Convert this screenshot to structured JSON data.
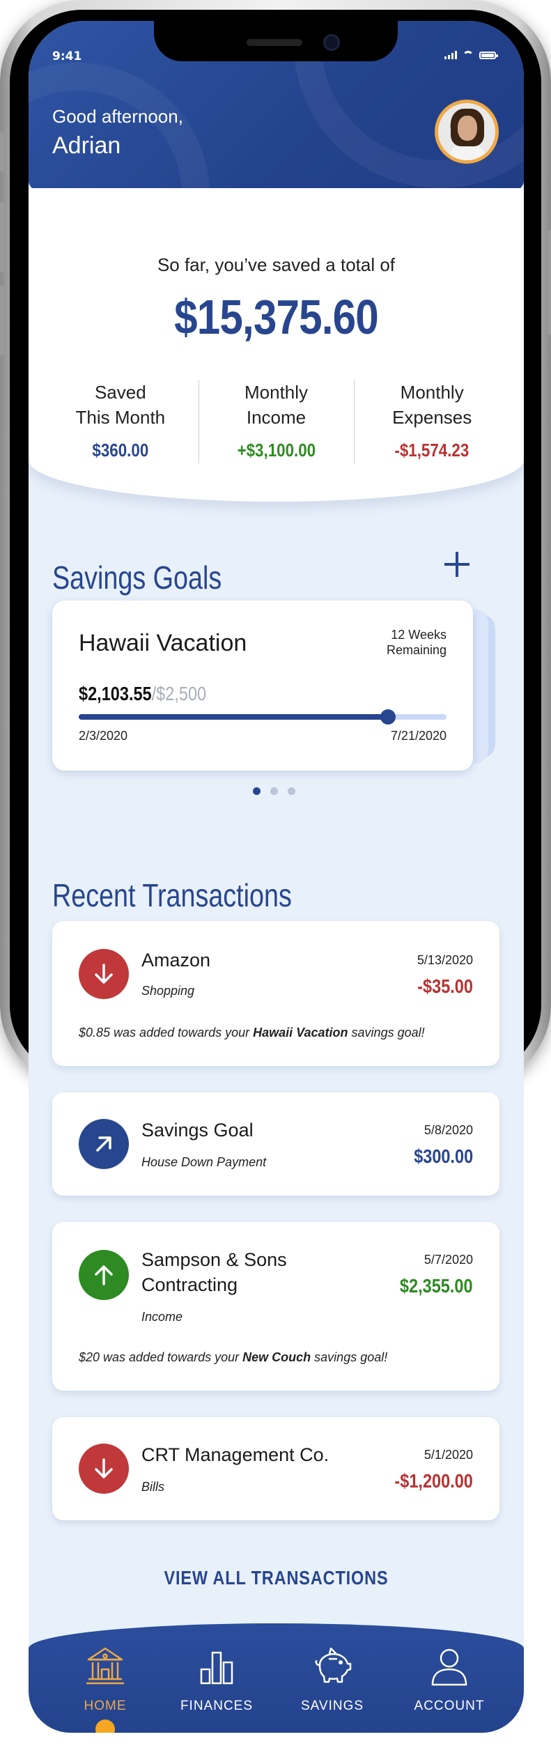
{
  "status": {
    "time": "9:41"
  },
  "header": {
    "greeting": "Good afternoon,",
    "user_name": "Adrian"
  },
  "summary": {
    "total_label": "So far, you’ve saved a total of",
    "total_amount": "$15,375.60",
    "stats": [
      {
        "label": "Saved\nThis Month",
        "value": "$360.00",
        "color": "#28468f"
      },
      {
        "label": "Monthly\nIncome",
        "value": "+$3,100.00",
        "color": "#2e8a22"
      },
      {
        "label": "Monthly\nExpenses",
        "value": "-$1,574.23",
        "color": "#b83232"
      }
    ]
  },
  "savings_goals": {
    "title": "Savings Goals",
    "current": {
      "name": "Hawaii Vacation",
      "remaining": "12 Weeks\nRemaining",
      "saved": "$2,103.55",
      "target": "/$2,500",
      "progress": 0.8414,
      "start_date": "2/3/2020",
      "end_date": "7/21/2020"
    },
    "page_count": 3,
    "active_page": 0
  },
  "transactions": {
    "title": "Recent Transactions",
    "items": [
      {
        "name": "Amazon",
        "category": "Shopping",
        "date": "5/13/2020",
        "amount": "-$35.00",
        "amount_color": "#b83232",
        "icon": "arrow-down-icon",
        "icon_color": "#c0383a",
        "note_pre": "$0.85 was added towards your ",
        "note_bold": "Hawaii Vacation",
        "note_post": " savings goal!"
      },
      {
        "name": "Savings Goal",
        "category": "House Down Payment",
        "date": "5/8/2020",
        "amount": "$300.00",
        "amount_color": "#28468f",
        "icon": "arrow-up-right-icon",
        "icon_color": "#28468f"
      },
      {
        "name": "Sampson & Sons\nContracting",
        "category": "Income",
        "date": "5/7/2020",
        "amount": "$2,355.00",
        "amount_color": "#2e8a22",
        "icon": "arrow-up-icon",
        "icon_color": "#2e8a22",
        "note_pre": "$20 was added towards your ",
        "note_bold": "New Couch",
        "note_post": " savings goal!"
      },
      {
        "name": "CRT Management Co.",
        "category": "Bills",
        "date": "5/1/2020",
        "amount": "-$1,200.00",
        "amount_color": "#b83232",
        "icon": "arrow-down-icon",
        "icon_color": "#c0383a"
      }
    ],
    "view_all": "VIEW ALL TRANSACTIONS"
  },
  "nav": {
    "items": [
      {
        "label": "HOME",
        "icon": "bank-icon",
        "active": true
      },
      {
        "label": "FINANCES",
        "icon": "bar-chart-icon",
        "active": false
      },
      {
        "label": "SAVINGS",
        "icon": "piggy-bank-icon",
        "active": false
      },
      {
        "label": "ACCOUNT",
        "icon": "user-icon",
        "active": false
      }
    ]
  },
  "colors": {
    "primary": "#28468f",
    "accent": "#f0a946",
    "positive": "#2e8a22",
    "negative": "#b83232"
  }
}
